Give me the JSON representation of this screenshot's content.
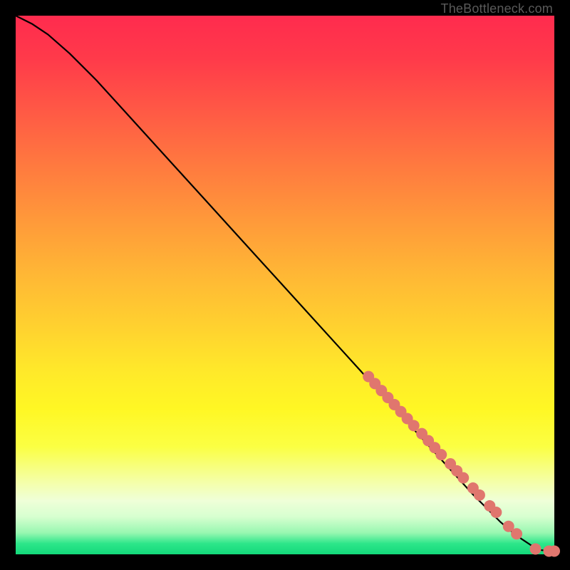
{
  "attribution": "TheBottleneck.com",
  "colors": {
    "curve": "#000000",
    "marker": "#e0766e",
    "background": "#000000"
  },
  "chart_data": {
    "type": "line",
    "title": "",
    "xlabel": "",
    "ylabel": "",
    "xlim": [
      0,
      100
    ],
    "ylim": [
      0,
      100
    ],
    "grid": false,
    "legend": false,
    "series": [
      {
        "name": "bottleneck-curve",
        "x": [
          0,
          3,
          6,
          10,
          15,
          20,
          25,
          30,
          35,
          40,
          45,
          50,
          55,
          60,
          65,
          70,
          75,
          80,
          85,
          90,
          92,
          94,
          95.5,
          96.5,
          97.5,
          99,
          100
        ],
        "y": [
          100,
          98.5,
          96.5,
          93,
          88,
          82.5,
          77,
          71.5,
          66,
          60.5,
          55,
          49.5,
          44,
          38.5,
          33,
          27.5,
          22,
          16.5,
          11,
          6,
          4.3,
          2.8,
          1.8,
          1.2,
          0.8,
          0.6,
          0.6
        ]
      }
    ],
    "markers": [
      {
        "x": 65.5,
        "y": 33.0
      },
      {
        "x": 66.7,
        "y": 31.7
      },
      {
        "x": 67.9,
        "y": 30.4
      },
      {
        "x": 69.1,
        "y": 29.1
      },
      {
        "x": 70.3,
        "y": 27.8
      },
      {
        "x": 71.5,
        "y": 26.5
      },
      {
        "x": 72.7,
        "y": 25.2
      },
      {
        "x": 73.9,
        "y": 23.9
      },
      {
        "x": 75.4,
        "y": 22.4
      },
      {
        "x": 76.6,
        "y": 21.1
      },
      {
        "x": 77.8,
        "y": 19.8
      },
      {
        "x": 79.0,
        "y": 18.5
      },
      {
        "x": 80.7,
        "y": 16.8
      },
      {
        "x": 81.9,
        "y": 15.5
      },
      {
        "x": 83.1,
        "y": 14.2
      },
      {
        "x": 84.9,
        "y": 12.3
      },
      {
        "x": 86.1,
        "y": 11.0
      },
      {
        "x": 88.0,
        "y": 9.0
      },
      {
        "x": 89.2,
        "y": 7.8
      },
      {
        "x": 91.5,
        "y": 5.2
      },
      {
        "x": 93.0,
        "y": 3.8
      },
      {
        "x": 96.5,
        "y": 1.0
      },
      {
        "x": 99.0,
        "y": 0.6
      },
      {
        "x": 100.0,
        "y": 0.6
      }
    ]
  }
}
